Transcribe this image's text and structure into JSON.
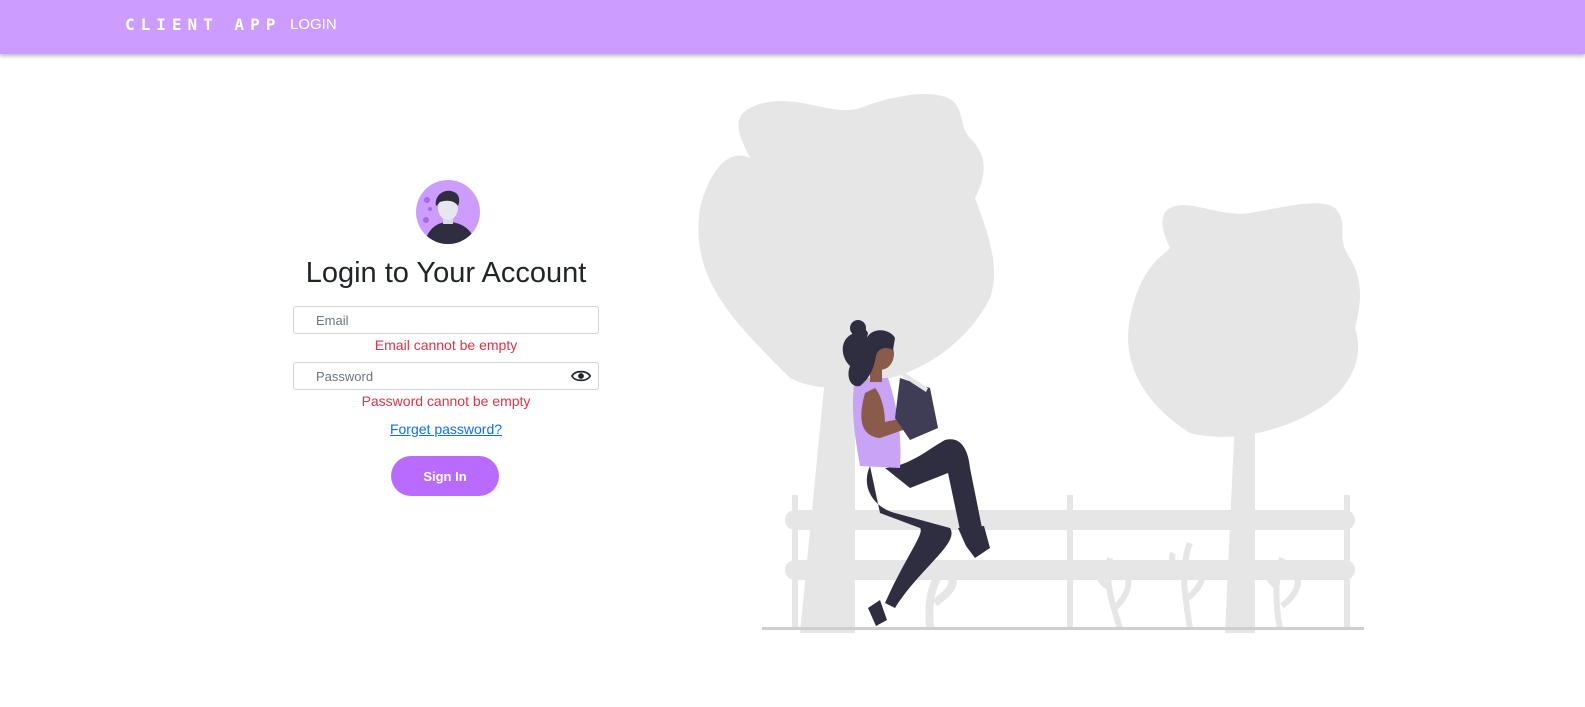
{
  "navbar": {
    "brand": "CLIENT APP",
    "login_link": "LOGIN"
  },
  "login": {
    "title": "Login to Your Account",
    "email_placeholder": "Email",
    "email_value": "",
    "email_error": "Email cannot be empty",
    "password_placeholder": "Password",
    "password_value": "",
    "password_error": "Password cannot be empty",
    "forgot_link": "Forget password?",
    "signin_label": "Sign In"
  },
  "icons": {
    "avatar": "user-avatar-icon",
    "eye": "eye-icon",
    "illustration": "woman-reading-on-fence-illustration"
  },
  "colors": {
    "navbar_bg": "#cc9cff",
    "accent": "#b96bff",
    "error": "#dc3545",
    "link": "#0d6efd"
  }
}
